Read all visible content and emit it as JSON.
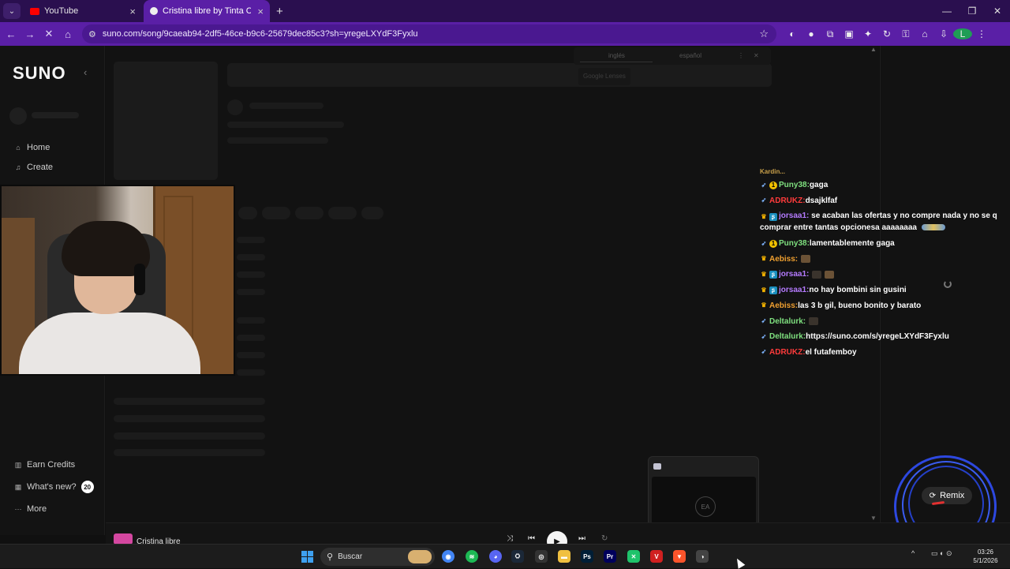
{
  "browser": {
    "tabs": [
      {
        "title": "YouTube",
        "icon": "youtube-icon",
        "color": "#ff0000"
      },
      {
        "title": "Cristina libre by Tinta China | S",
        "icon": "suno-icon",
        "color": "#ffffff"
      }
    ],
    "url": "suno.com/song/9caeab94-2df5-46ce-b9c6-25679dec85c3?sh=yregeLXYdF3Fyxlu",
    "profile_initial": "L"
  },
  "suno": {
    "logo": "SUNO",
    "nav": [
      {
        "label": "Home",
        "icon": "home-icon"
      },
      {
        "label": "Create",
        "icon": "music-note-icon"
      }
    ],
    "bottom_nav": [
      {
        "label": "Earn Credits",
        "icon": "gift-icon"
      },
      {
        "label": "What's new?",
        "icon": "bell-icon",
        "badge": "20"
      },
      {
        "label": "More",
        "icon": "more-icon"
      }
    ],
    "lang_tabs": [
      "inglés",
      "español"
    ],
    "translated_placeholder": "Google Lenses",
    "remix_label": "Remix",
    "player": {
      "title": "Cristina libre"
    }
  },
  "chat": {
    "truncated_top": "Kardin...",
    "messages": [
      {
        "user": "Puny38",
        "color": "#7fe07f",
        "badges": [
          "rocket",
          "coin"
        ],
        "text": "gaga"
      },
      {
        "user": "ADRUKZ",
        "color": "#ff3b3b",
        "badges": [
          "rocket"
        ],
        "text": "dsajklfaf"
      },
      {
        "user": "jorsaa1",
        "color": "#b57bff",
        "badges": [
          "crown",
          "gem"
        ],
        "text": "se acaban las ofertas y no compre nada y no se q comprar entre tantas opcionesa aaaaaaaa"
      },
      {
        "user": "Puny38",
        "color": "#7fe07f",
        "badges": [
          "rocket",
          "coin"
        ],
        "text": "lamentablemente gaga"
      },
      {
        "user": "Aebiss",
        "color": "#f0a030",
        "badges": [
          "crown"
        ],
        "text": ""
      },
      {
        "user": "jorsaa1",
        "color": "#b57bff",
        "badges": [
          "crown",
          "gem"
        ],
        "text": ""
      },
      {
        "user": "jorsaa1",
        "color": "#b57bff",
        "badges": [
          "crown",
          "gem"
        ],
        "text": "no hay bombini sin gusini"
      },
      {
        "user": "Aebiss",
        "color": "#f0a030",
        "badges": [
          "crown"
        ],
        "text": "las 3 b gil, bueno bonito y barato"
      },
      {
        "user": "Deltalurk",
        "color": "#7fe07f",
        "badges": [
          "rocket"
        ],
        "text": ""
      },
      {
        "user": "Deltalurk",
        "color": "#7fe07f",
        "badges": [
          "rocket"
        ],
        "text": "https://suno.com/s/yregeLXYdF3Fyxlu"
      },
      {
        "user": "ADRUKZ",
        "color": "#ff3b3b",
        "badges": [
          "rocket"
        ],
        "text": "el futafemboy"
      }
    ]
  },
  "taskbar": {
    "search_placeholder": "Buscar",
    "time": "03:26",
    "date": "5/1/2026",
    "apps": [
      "chrome-icon",
      "spotify-icon",
      "discord-icon",
      "steam-icon",
      "github-icon",
      "file-explorer-icon",
      "photoshop-icon",
      "premiere-icon",
      "capcut-icon",
      "voicemeeter-icon",
      "brave-icon",
      "obs-icon"
    ]
  },
  "popup": {
    "icon": "obs-icon",
    "thumb_label": "EA"
  },
  "colors": {
    "browser_tab_bar": "#2a0f4f",
    "browser_toolbar": "#5a1fa6",
    "remix_ring": "#2d48e0"
  }
}
